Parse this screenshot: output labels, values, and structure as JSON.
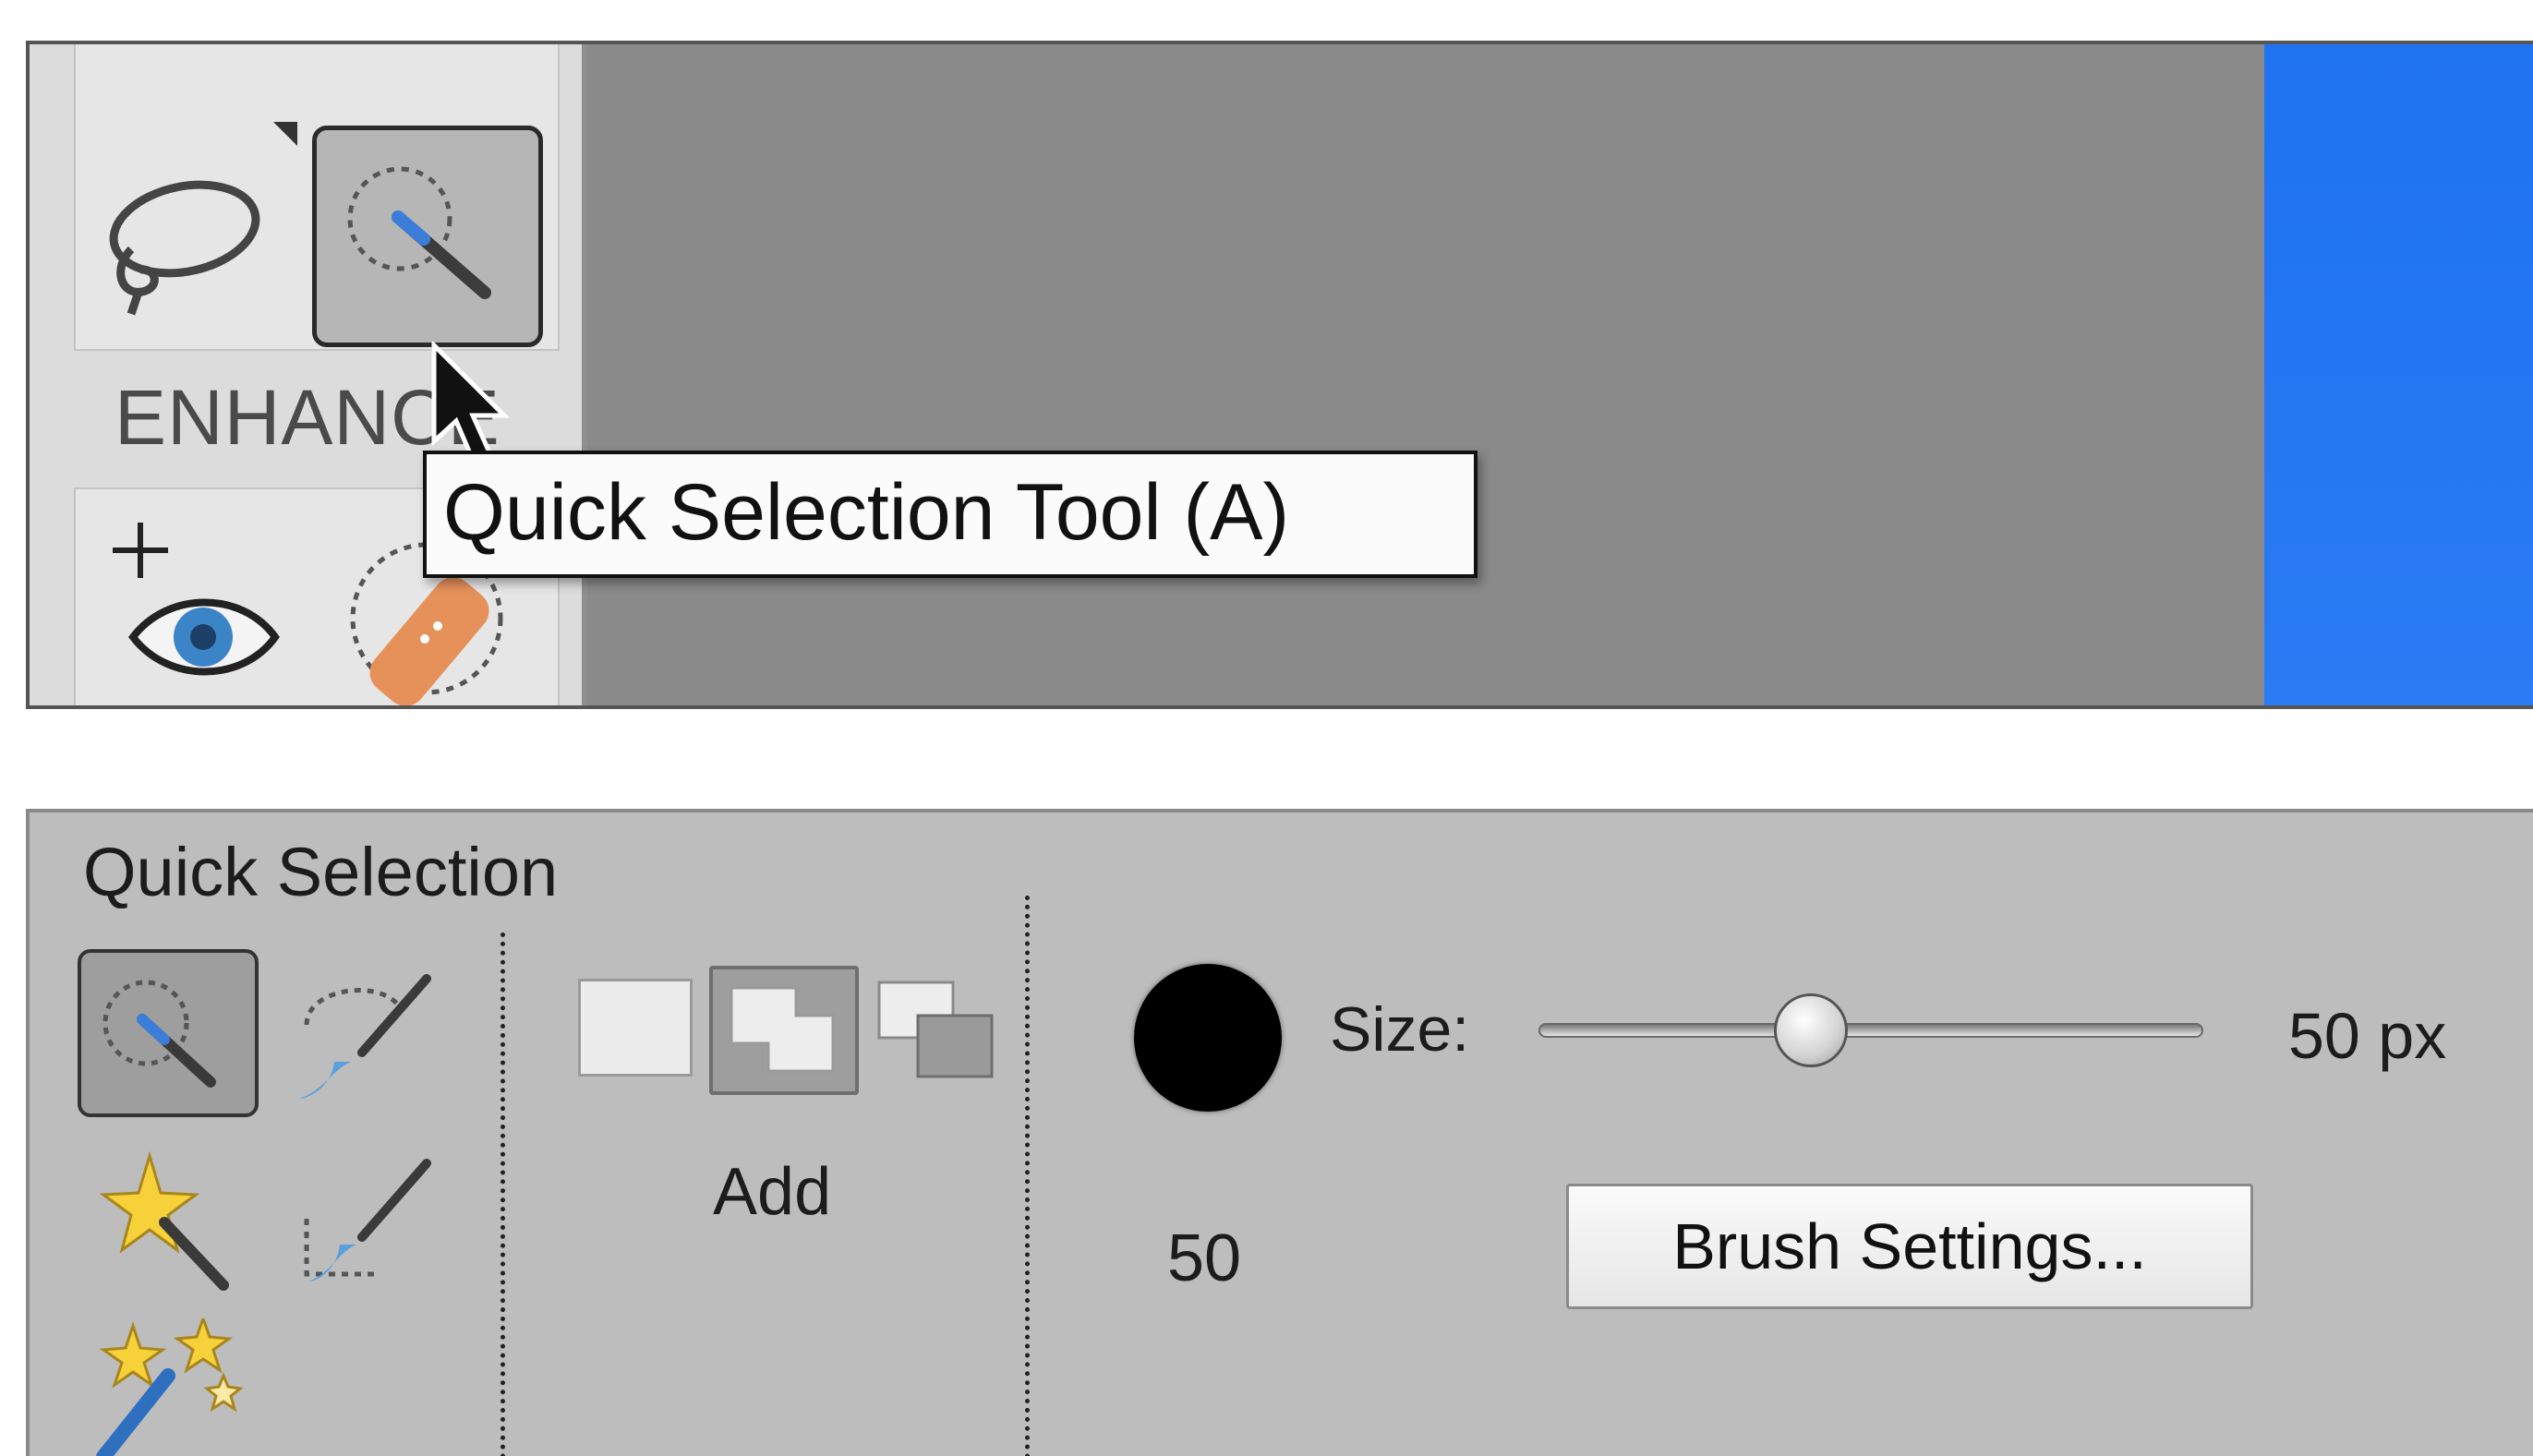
{
  "toolbox": {
    "section_label": "ENHANCE",
    "tools": [
      {
        "name": "Lasso Tool",
        "icon": "lasso-icon"
      },
      {
        "name": "Quick Selection Tool",
        "icon": "quick-selection-icon",
        "selected": true
      },
      {
        "name": "Red Eye Removal Tool",
        "icon": "red-eye-icon"
      },
      {
        "name": "Spot Healing Brush Tool",
        "icon": "healing-brush-icon"
      }
    ]
  },
  "tooltip": {
    "text": "Quick Selection Tool (A)"
  },
  "options_bar": {
    "title": "Quick Selection",
    "tools": [
      {
        "icon": "quick-selection-icon",
        "selected": true
      },
      {
        "icon": "selection-brush-icon"
      },
      {
        "icon": "magic-wand-icon"
      },
      {
        "icon": "refine-selection-brush-icon"
      },
      {
        "icon": "auto-selection-icon"
      }
    ],
    "mode": {
      "label": "Add",
      "options": [
        "new",
        "add",
        "subtract"
      ],
      "selected": "add"
    },
    "brush": {
      "size_label": "Size:",
      "size_value": "50 px",
      "size_number": "50",
      "slider_fraction": 0.41
    },
    "brush_settings_label": "Brush Settings..."
  },
  "colors": {
    "canvas_gray": "#8a8a8a",
    "canvas_blue": "#1f72f0",
    "panel_bg": "#bdbdbd",
    "toolbox_bg": "#dcdcdc"
  }
}
